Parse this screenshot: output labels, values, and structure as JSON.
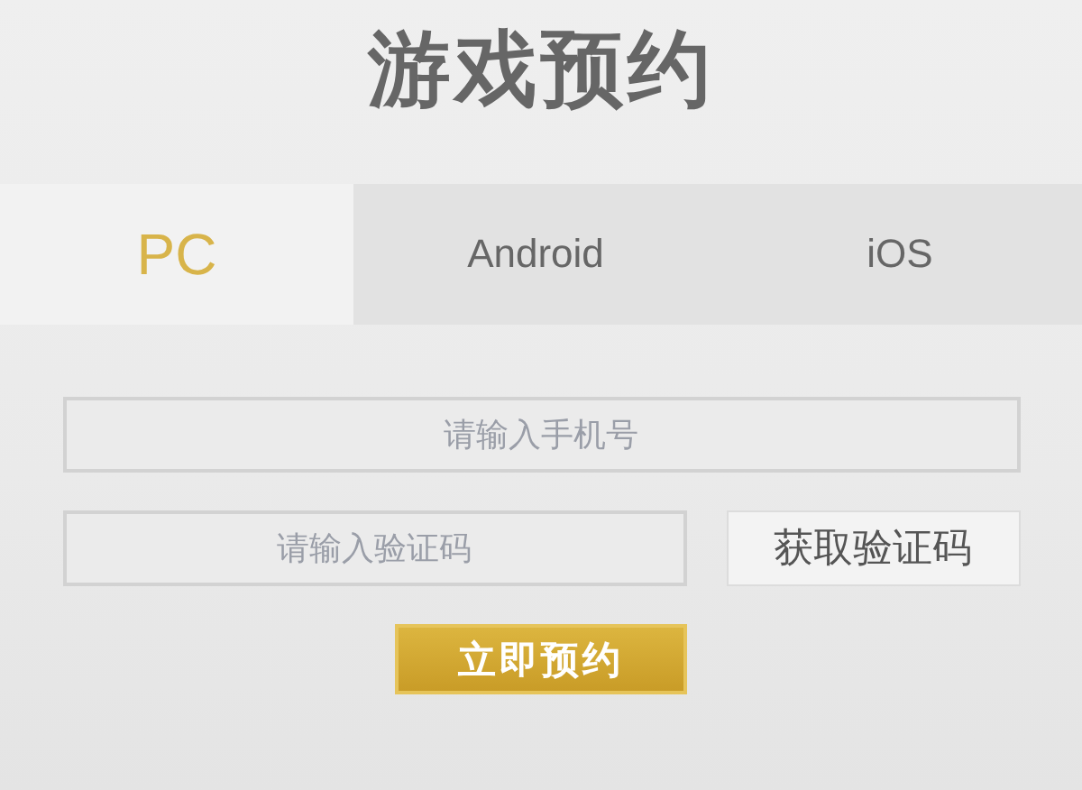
{
  "title": "游戏预约",
  "tabs": [
    {
      "label": "PC",
      "selected": true
    },
    {
      "label": "Android",
      "selected": false
    },
    {
      "label": "iOS",
      "selected": false
    }
  ],
  "phone_field": {
    "placeholder": "请输入手机号"
  },
  "code_field": {
    "placeholder": "请输入验证码"
  },
  "get_code_button": "获取验证码",
  "submit_button": "立即预约"
}
